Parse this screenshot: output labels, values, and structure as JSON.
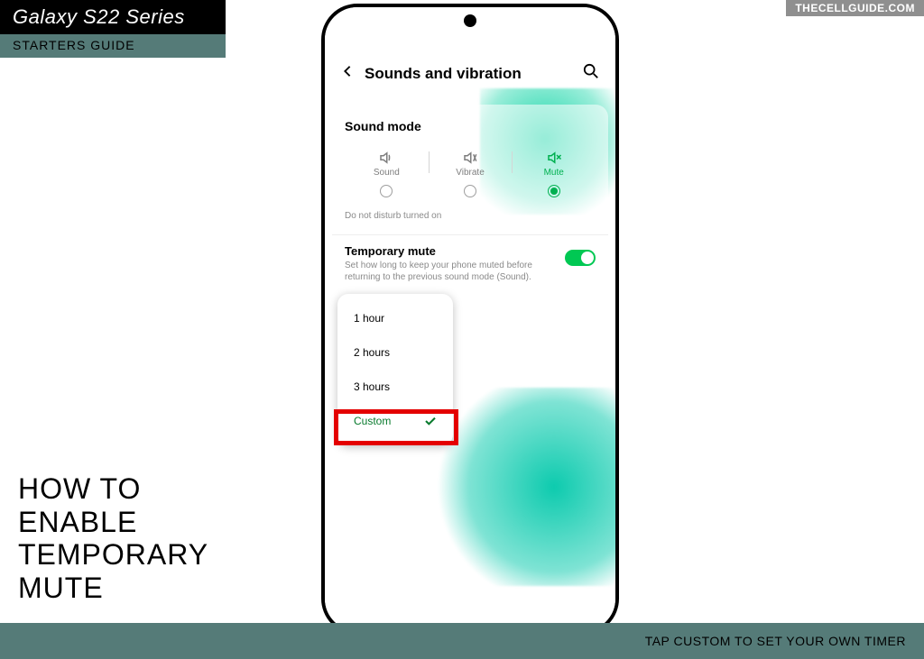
{
  "brand": {
    "series": "Galaxy S22 Series",
    "subtitle": "STARTERS GUIDE"
  },
  "watermark": "THECELLGUIDE.COM",
  "screen": {
    "header_title": "Sounds and vibration",
    "sound_mode_label": "Sound mode",
    "modes": {
      "sound": "Sound",
      "vibrate": "Vibrate",
      "mute": "Mute"
    },
    "dnd_status": "Do not disturb turned on",
    "temporary_mute": {
      "title": "Temporary mute",
      "desc": "Set how long to keep your phone muted before returning to the previous sound mode (Sound).",
      "toggle": true
    },
    "popup": {
      "options": [
        "1 hour",
        "2 hours",
        "3 hours",
        "Custom"
      ],
      "selected": "Custom"
    }
  },
  "headline": "HOW TO\nENABLE\nTEMPORARY\nMUTE",
  "footer": "TAP CUSTOM TO SET YOUR OWN TIMER"
}
